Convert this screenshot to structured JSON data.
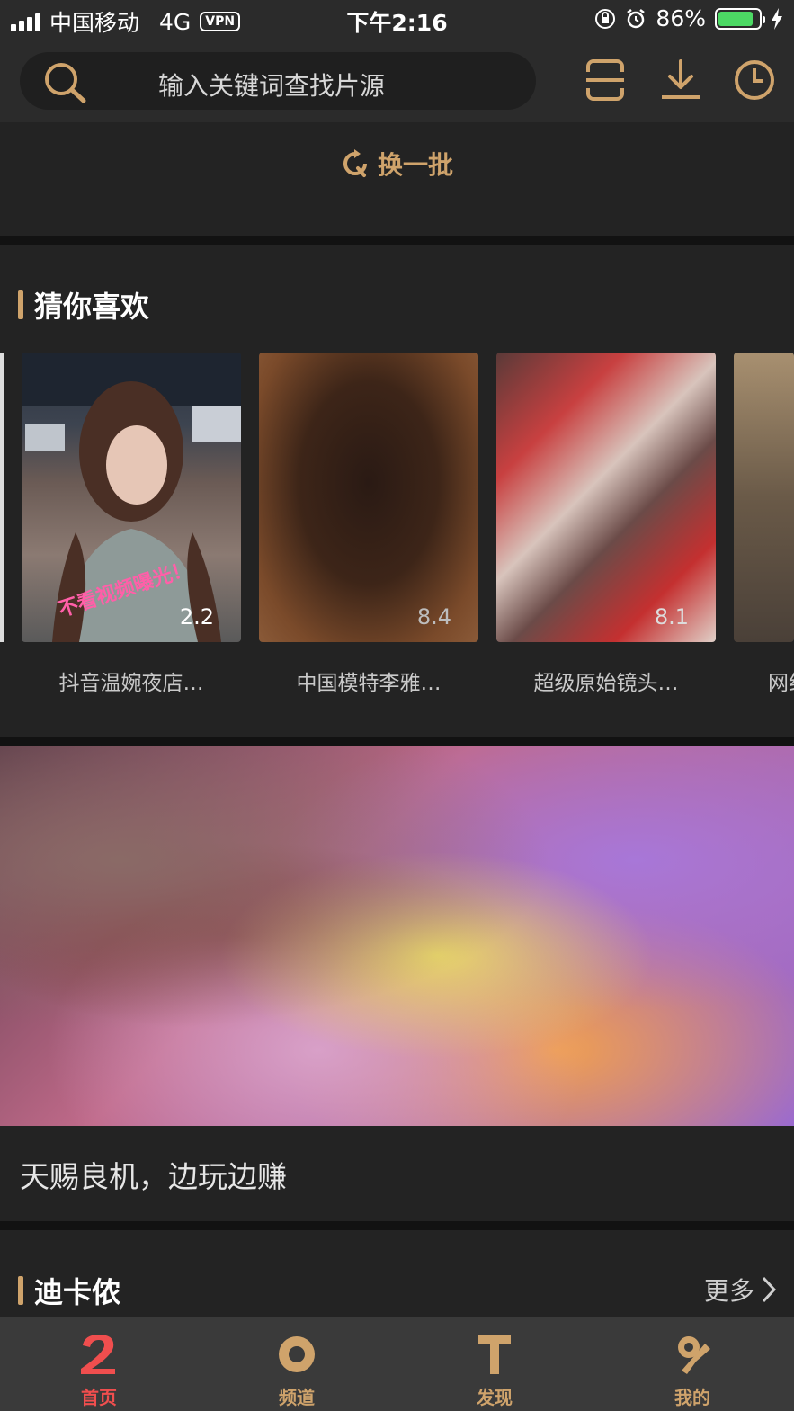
{
  "status_bar": {
    "carrier": "中国移动",
    "network": "4G",
    "vpn": "VPN",
    "time": "下午2:16",
    "battery": "86%",
    "battery_level": 0.86
  },
  "search": {
    "placeholder": "输入关键词查找片源"
  },
  "refresh": {
    "label": "换一批"
  },
  "guess_section": {
    "title": "猜你喜欢",
    "items": [
      {
        "title": "抖音温婉夜店…",
        "score": "2.2"
      },
      {
        "title": "中国模特李雅…",
        "score": "8.4"
      },
      {
        "title": "超级原始镜头…",
        "score": "8.1"
      },
      {
        "title": "网红…",
        "score": ""
      }
    ]
  },
  "promo": {
    "caption": "天赐良机，边玩边赚"
  },
  "dika_section": {
    "title": "迪卡侬",
    "more_label": "更多"
  },
  "tab_bar": {
    "tabs": [
      {
        "label": "首页",
        "icon": "home-icon",
        "active": true
      },
      {
        "label": "频道",
        "icon": "channel-icon",
        "active": false
      },
      {
        "label": "发现",
        "icon": "discover-icon",
        "active": false
      },
      {
        "label": "我的",
        "icon": "profile-icon",
        "active": false
      }
    ]
  },
  "colors": {
    "accent": "#cfa36b",
    "active_tab": "#f04e4e",
    "background": "#232323"
  }
}
